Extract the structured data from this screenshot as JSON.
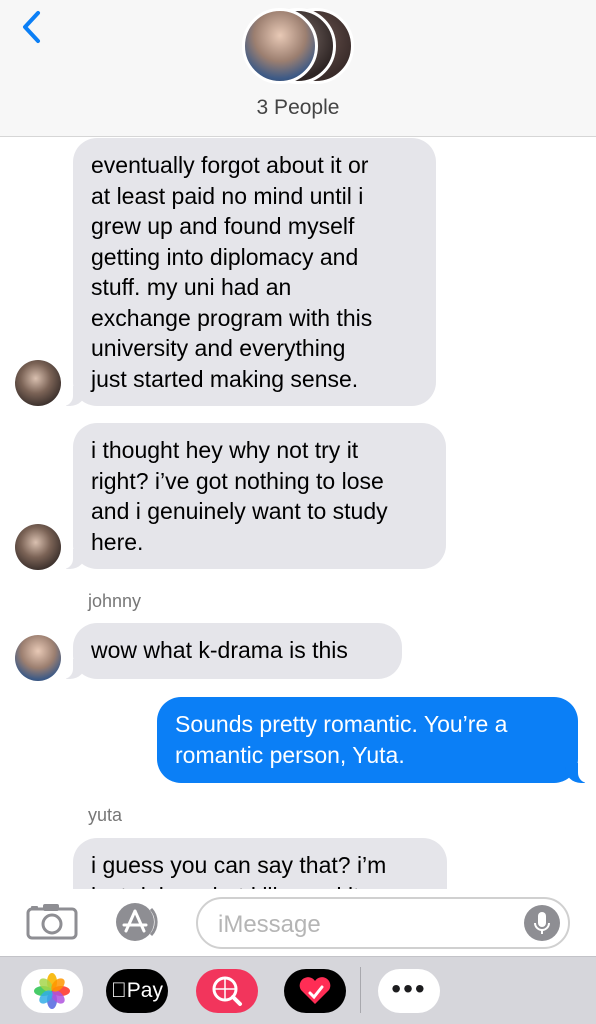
{
  "header": {
    "group_label": "3 People"
  },
  "thread": {
    "messages": [
      {
        "direction": "incoming",
        "lines": [
          "eventually forgot about it or",
          "at least paid no mind until i",
          "grew up and found myself",
          "getting into diplomacy and",
          "stuff. my uni had an",
          "exchange program with this",
          "university and everything",
          "just started making sense."
        ]
      },
      {
        "direction": "incoming",
        "lines": [
          "i thought hey why not try it",
          "right? i’ve got nothing to lose",
          "and i genuinely want to study",
          "here."
        ]
      },
      {
        "direction": "incoming",
        "sender": "johnny",
        "lines": [
          "wow what k-drama is this"
        ]
      },
      {
        "direction": "outgoing",
        "lines": [
          "Sounds pretty romantic. You’re a",
          "romantic person, Yuta."
        ]
      },
      {
        "direction": "incoming",
        "sender": "yuta",
        "lines": [
          "i guess you can say that? i’m",
          "just doing what i like and it"
        ]
      }
    ]
  },
  "composer": {
    "placeholder": "iMessage"
  },
  "drawer": {
    "pay_label": "Pay",
    "more_label": "•••"
  },
  "colors": {
    "outgoing_bubble": "#0b7ff6",
    "incoming_bubble": "#e5e5ea",
    "accent": "#0b7ff6"
  },
  "icons": [
    "back-chevron-icon",
    "camera-icon",
    "app-store-icon",
    "microphone-icon",
    "photos-icon",
    "apple-pay-icon",
    "search-images-icon",
    "digital-touch-icon",
    "more-icon"
  ]
}
